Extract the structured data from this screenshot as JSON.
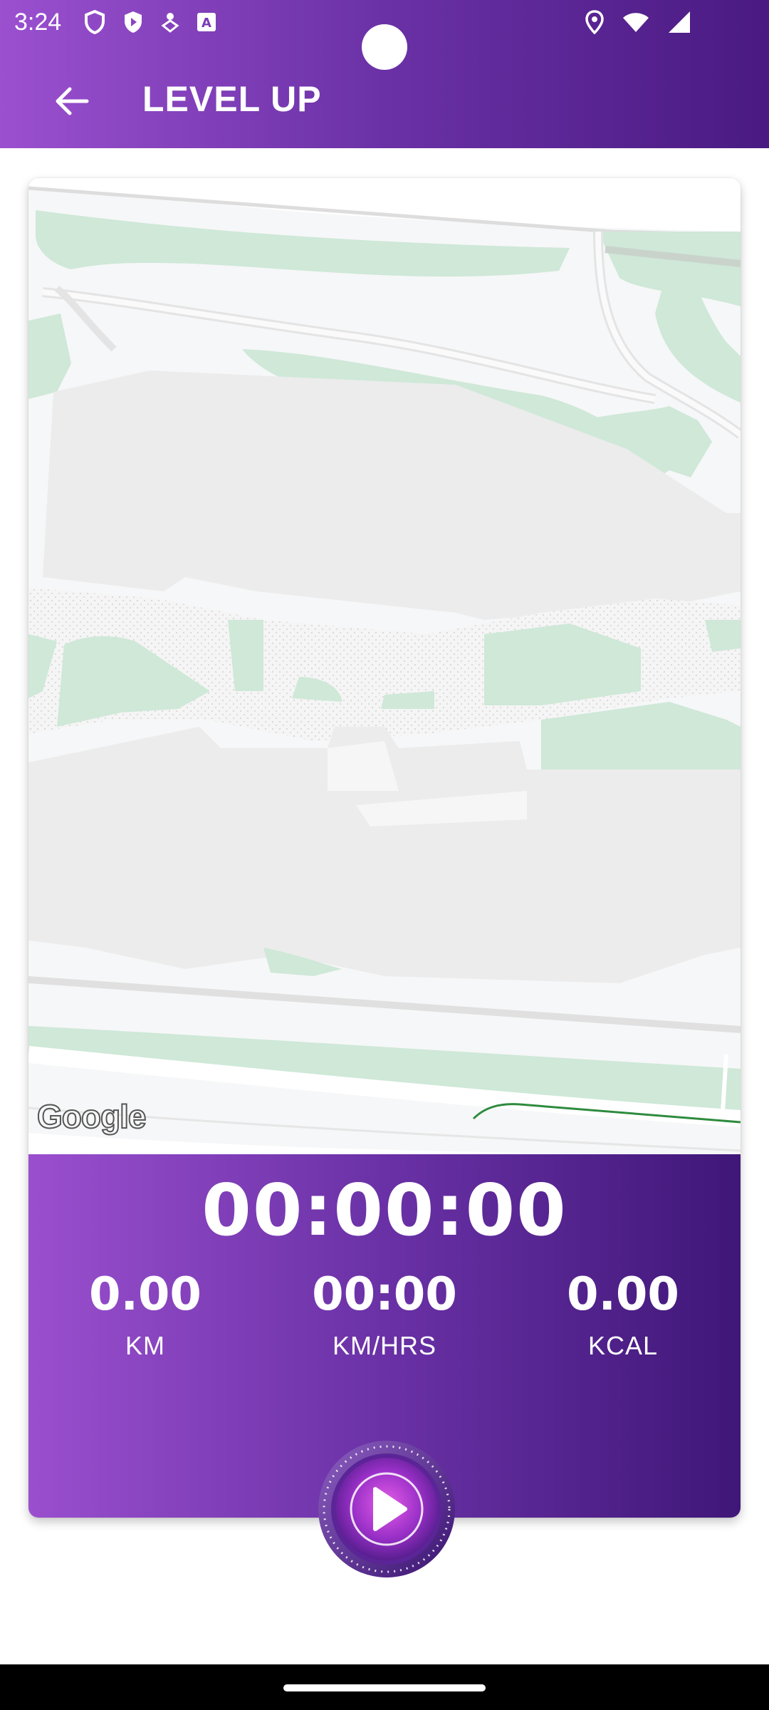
{
  "status_bar": {
    "time": "3:24",
    "left_icons": [
      "shield-outline-icon",
      "shield-play-icon",
      "person-pin-icon",
      "text-a-icon"
    ],
    "right_icons": [
      "location-icon",
      "wifi-icon",
      "signal-icon"
    ]
  },
  "app_bar": {
    "title": "LEVEL UP",
    "back_icon": "arrow-back-icon"
  },
  "map": {
    "attribution": "Google"
  },
  "stats": {
    "timer": "00:00:00",
    "distance": {
      "value": "0.00",
      "label": "KM"
    },
    "speed": {
      "value": "00:00",
      "label": "KM/HRS"
    },
    "calories": {
      "value": "0.00",
      "label": "KCAL"
    }
  },
  "controls": {
    "play_icon": "play-icon"
  },
  "colors": {
    "brand_start": "#9b50cf",
    "brand_end": "#4a1a82",
    "park_green": "#cfe8d8",
    "building_gray": "#ececec"
  }
}
